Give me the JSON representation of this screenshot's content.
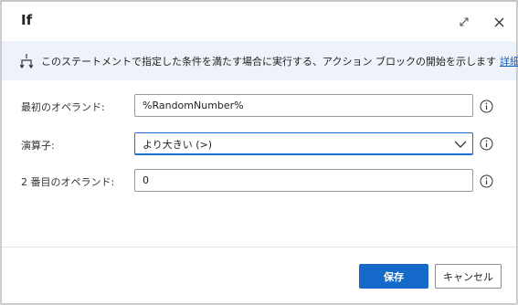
{
  "dialog": {
    "title": "If",
    "icons": {
      "expand": "expand-icon",
      "close": "close-icon"
    }
  },
  "banner": {
    "icon": "flow-branch-icon",
    "text": "このステートメントで指定した条件を満たす場合に実行する、アクション ブロックの開始を示します",
    "link": "詳細"
  },
  "fields": {
    "first_operand": {
      "label": "最初のオペランド:",
      "value": "%RandomNumber%"
    },
    "operator": {
      "label": "演算子:",
      "selected": "より大きい (>)"
    },
    "second_operand": {
      "label": "2 番目のオペランド:",
      "value": "0"
    }
  },
  "footer": {
    "save": "保存",
    "cancel": "キャンセル"
  },
  "colors": {
    "primary": "#1469c9",
    "banner_bg": "#eef3fa",
    "link": "#1a5fb4"
  }
}
